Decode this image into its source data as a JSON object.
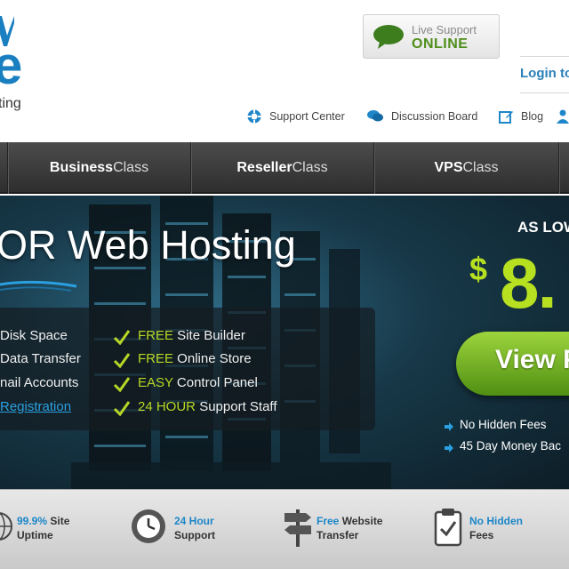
{
  "header": {
    "logo_tagline": "ting",
    "live_support": {
      "line1": "Live Support",
      "line2": "ONLINE"
    },
    "login_label": "Login to",
    "top_links": [
      {
        "label": "Support Center",
        "icon": "lifebuoy-icon"
      },
      {
        "label": "Discussion Board",
        "icon": "chat-bubbles-icon"
      },
      {
        "label": "Blog",
        "icon": "edit-icon"
      },
      {
        "label": "",
        "icon": "user-icon"
      }
    ]
  },
  "nav": {
    "items": [
      {
        "bold": "Business",
        "rest": "Class"
      },
      {
        "bold": "Reseller",
        "rest": "Class"
      },
      {
        "bold": "VPS",
        "rest": "Class"
      }
    ]
  },
  "hero": {
    "title": "OR Web Hosting",
    "features_left": [
      "Disk Space",
      "Data Transfer",
      "nail Accounts",
      "Registration"
    ],
    "features_right": [
      {
        "hl": "FREE",
        "text": " Site Builder"
      },
      {
        "hl": "FREE",
        "text": " Online Store"
      },
      {
        "hl": "EASY",
        "text": " Control Panel"
      },
      {
        "hl": "24 HOUR",
        "text": " Support Staff"
      }
    ],
    "as_low": "AS LOW",
    "dollar": "$",
    "price": "8.",
    "cta_label": "View P",
    "bullets": [
      "No Hidden Fees",
      "45 Day Money Bac"
    ]
  },
  "bottom": {
    "items": [
      {
        "hl": "99.9%",
        "text": " Site",
        "line2": "Uptime",
        "icon": "globe-icon"
      },
      {
        "hl": "24 Hour",
        "text": "",
        "line2": "Support",
        "icon": "clock-icon"
      },
      {
        "hl": "Free",
        "text": " Website",
        "line2": "Transfer",
        "icon": "signpost-icon"
      },
      {
        "hl": "No Hidden",
        "text": "",
        "line2": "Fees",
        "icon": "clipboard-icon"
      }
    ]
  },
  "colors": {
    "brand_blue": "#1a7fc1",
    "accent_green": "#b7e020",
    "link_blue": "#2a7fb8",
    "nav_dark": "#3a3a3a"
  }
}
